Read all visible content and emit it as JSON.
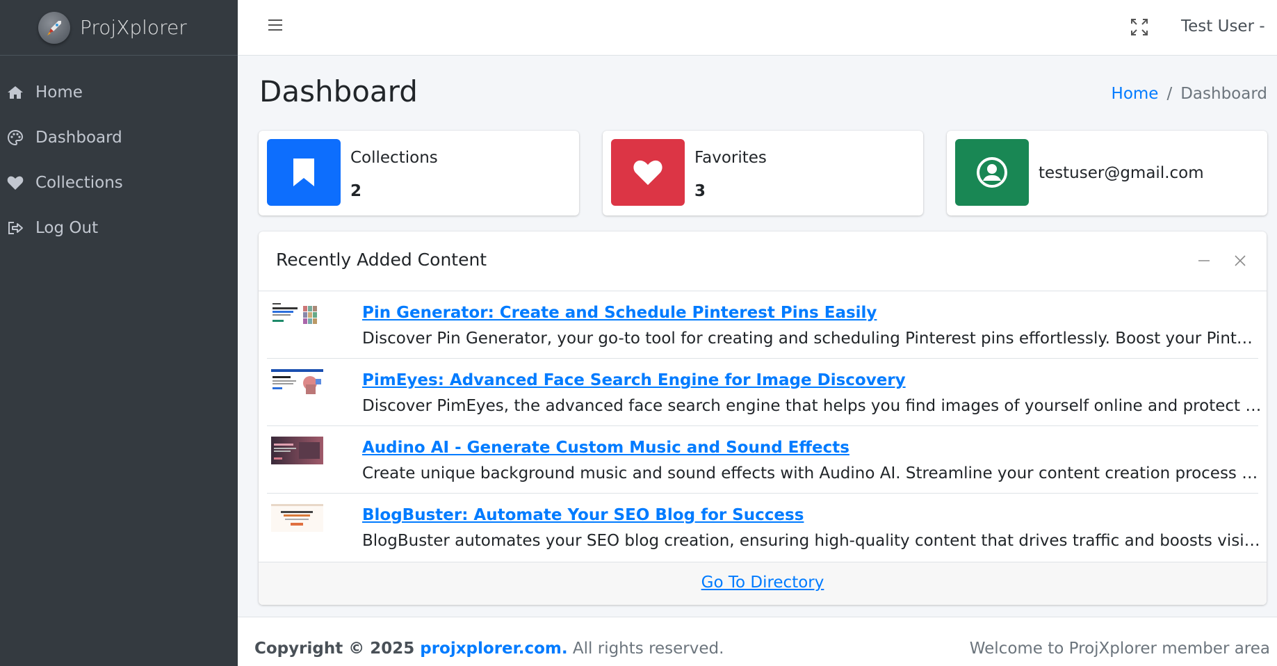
{
  "brand": {
    "name": "ProjXplorer",
    "logo_icon": "rocket-icon"
  },
  "sidebar": {
    "items": [
      {
        "label": "Home",
        "icon": "home-icon"
      },
      {
        "label": "Dashboard",
        "icon": "palette-icon"
      },
      {
        "label": "Collections",
        "icon": "heart-icon"
      },
      {
        "label": "Log Out",
        "icon": "logout-icon"
      }
    ]
  },
  "header": {
    "user_label": "Test User -",
    "menu_icon": "hamburger-icon",
    "fullscreen_icon": "expand-icon"
  },
  "page": {
    "title": "Dashboard",
    "breadcrumb": {
      "home": "Home",
      "separator": "/",
      "current": "Dashboard"
    }
  },
  "stats": {
    "collections": {
      "label": "Collections",
      "value": "2",
      "color": "#0d6efd",
      "icon": "bookmark-icon"
    },
    "favorites": {
      "label": "Favorites",
      "value": "3",
      "color": "#dc3545",
      "icon": "heart-icon"
    },
    "account": {
      "email": "testuser@gmail.com",
      "color": "#198754",
      "icon": "user-circle-icon"
    }
  },
  "recent": {
    "title": "Recently Added Content",
    "items": [
      {
        "title": "Pin Generator: Create and Schedule Pinterest Pins Easily",
        "description": "Discover Pin Generator, your go-to tool for creating and scheduling Pinterest pins effortlessly. Boost your Pinterest marketing today!"
      },
      {
        "title": "PimEyes: Advanced Face Search Engine for Image Discovery",
        "description": "Discover PimEyes, the advanced face search engine that helps you find images of yourself online and protect your privacy."
      },
      {
        "title": "Audino AI - Generate Custom Music and Sound Effects",
        "description": "Create unique background music and sound effects with Audino AI. Streamline your content creation process with our powerful tool."
      },
      {
        "title": "BlogBuster: Automate Your SEO Blog for Success",
        "description": "BlogBuster automates your SEO blog creation, ensuring high-quality content that drives traffic and boosts visibility on search engines."
      }
    ],
    "footer_link": "Go To Directory"
  },
  "footer": {
    "copyright": "Copyright © 2025",
    "site": "projxplorer.com.",
    "rights": "All rights reserved.",
    "welcome": "Welcome to ProjXplorer member area"
  }
}
